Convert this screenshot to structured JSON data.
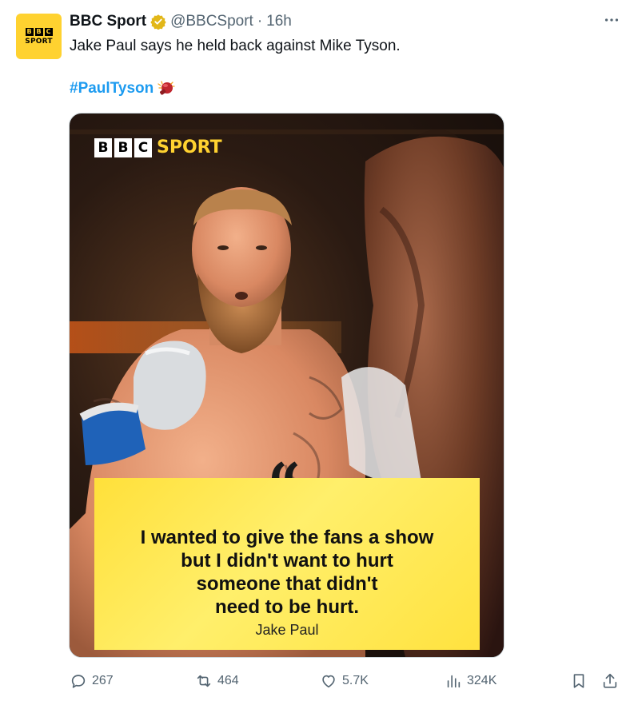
{
  "tweet": {
    "author_name": "BBC Sport",
    "handle": "@BBCSport",
    "separator": "·",
    "time": "16h",
    "text": "Jake Paul says he held back against Mike Tyson.",
    "hashtag": "#PaulTyson",
    "avatar": {
      "bbc_letters": [
        "B",
        "B",
        "C"
      ],
      "sport": "SPORT"
    }
  },
  "media": {
    "logo": {
      "letters": [
        "B",
        "B",
        "C"
      ],
      "word": "SPORT"
    },
    "quote_mark": "“",
    "quote_lines": [
      "I wanted to give the fans a show",
      "but I didn't want to hurt",
      "someone that didn't",
      "need to be hurt."
    ],
    "quote_author": "Jake Paul"
  },
  "actions": {
    "replies": "267",
    "reposts": "464",
    "likes": "5.7K",
    "views": "324K"
  },
  "icons": {
    "more": "more-icon",
    "verified": "verified-badge-icon",
    "reply": "reply-icon",
    "repost": "repost-icon",
    "like": "heart-icon",
    "views": "views-icon",
    "bookmark": "bookmark-icon",
    "share": "share-icon"
  },
  "colors": {
    "link": "#1d9bf0",
    "secondary_text": "#536471",
    "brand_yellow": "#ffd230",
    "verified_gold": "#e2b719"
  }
}
